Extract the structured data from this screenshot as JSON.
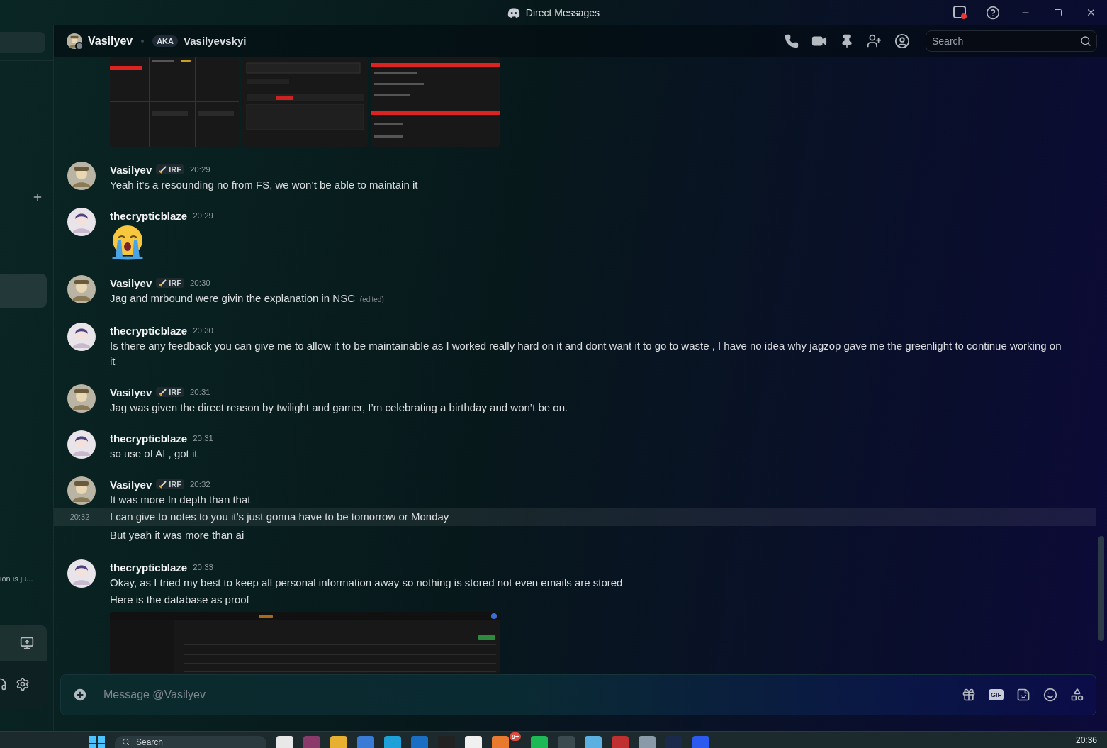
{
  "window": {
    "title": "Direct Messages"
  },
  "sidebar": {
    "rows": [
      {
        "selected": true
      },
      {
        "selected": false,
        "snippet": "ion is ju..."
      }
    ]
  },
  "header": {
    "name": "Vasilyev",
    "status_dot": {
      "color": "#80848e"
    },
    "aka_label": "AKA",
    "aka_name": "Vasilyevskyi",
    "search": {
      "placeholder": "Search"
    }
  },
  "top_attachments": [
    {
      "kind": "picture"
    },
    {
      "kind": "picture"
    },
    {
      "kind": "picture"
    }
  ],
  "groups": [
    {
      "author": "Vasilyev",
      "avatar": {
        "kind": "cap"
      },
      "tag": "IRF",
      "time": "20:29",
      "lines": [
        {
          "kind": "text",
          "text": "Yeah it’s a resounding no from FS, we won’t be able to maintain it",
          "hovered": false
        }
      ]
    },
    {
      "author": "thecrypticblaze",
      "avatar": {
        "kind": "hair"
      },
      "time": "20:29",
      "lines": [
        {
          "kind": "emoji",
          "hovered": false
        }
      ]
    },
    {
      "author": "Vasilyev",
      "avatar": {
        "kind": "cap"
      },
      "tag": "IRF",
      "time": "20:30",
      "lines": [
        {
          "kind": "text",
          "text": "Jag and mrbound were givin the explanation in NSC",
          "edited": "(edited)",
          "hovered": false
        }
      ]
    },
    {
      "author": "thecrypticblaze",
      "avatar": {
        "kind": "hair"
      },
      "time": "20:30",
      "lines": [
        {
          "kind": "text",
          "text": "Is there any feedback you can give me to allow it to be maintainable as I worked really hard on it and dont want it to go to waste , I have no idea why jagzop gave me the greenlight to continue working on it",
          "hovered": false
        }
      ]
    },
    {
      "author": "Vasilyev",
      "avatar": {
        "kind": "cap"
      },
      "tag": "IRF",
      "time": "20:31",
      "lines": [
        {
          "kind": "text",
          "text": "Jag was given the direct reason by twilight and gamer, I’m celebrating a birthday and won’t be on.",
          "hovered": false
        }
      ]
    },
    {
      "author": "thecrypticblaze",
      "avatar": {
        "kind": "hair"
      },
      "time": "20:31",
      "lines": [
        {
          "kind": "text",
          "text": "so use of AI , got it",
          "hovered": false
        }
      ]
    },
    {
      "author": "Vasilyev",
      "avatar": {
        "kind": "cap"
      },
      "tag": "IRF",
      "time": "20:32",
      "lines": [
        {
          "kind": "text",
          "text": "It was more In depth than that",
          "hovered": false
        },
        {
          "kind": "text",
          "text": "I can give to notes to you it’s just gonna have to be tomorrow or Monday",
          "hovered": true,
          "time": "20:32"
        },
        {
          "kind": "text",
          "text": "But yeah it was more than ai",
          "hovered": false
        }
      ]
    },
    {
      "author": "thecrypticblaze",
      "avatar": {
        "kind": "hair"
      },
      "time": "20:33",
      "lines": [
        {
          "kind": "text",
          "text": "Okay, as I tried my best to keep all personal information away so nothing is stored not even emails are stored",
          "hovered": false
        },
        {
          "kind": "text",
          "text": "Here is the database as proof",
          "hovered": false
        },
        {
          "kind": "picture",
          "hovered": false
        }
      ]
    }
  ],
  "composer": {
    "placeholder": "Message @Vasilyev",
    "gif_label": "GIF"
  },
  "taskbar": {
    "search": {
      "placeholder": "Search"
    },
    "badge": "9+",
    "clock": "20:36"
  }
}
